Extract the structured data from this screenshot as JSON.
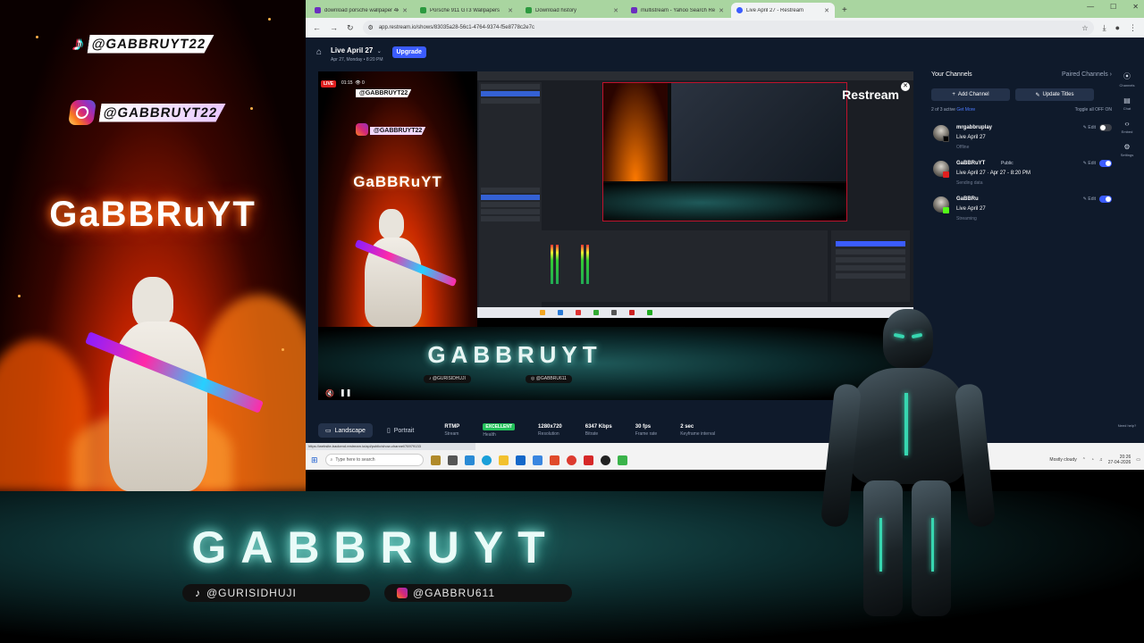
{
  "overlay": {
    "tiktok_handle": "@GABBRUYT22",
    "instagram_handle": "@GABBRUYT22",
    "brand_left": "GaBBRuYT",
    "brand_bottom": "GABBRUYT",
    "bottom_tiktok": "@GURISIDHUJI",
    "bottom_instagram": "@GABBRU611",
    "fire_color": "#ff6a00",
    "teal_glow": "#37d6b0"
  },
  "browser": {
    "tabs": [
      {
        "label": "download porsche wallpaper 4k",
        "favicon_color": "#6b2fbf",
        "active": false
      },
      {
        "label": "Porsche 911 GT3 Wallpapers",
        "favicon_color": "#2c9a3f",
        "active": false
      },
      {
        "label": "Download history",
        "favicon_color": "#2c9a3f",
        "active": false
      },
      {
        "label": "multistream - Yahoo Search Re",
        "favicon_color": "#6b2fbf",
        "active": false
      },
      {
        "label": "Live April 27 - Restream",
        "favicon_color": "#3b5cff",
        "active": true
      }
    ],
    "new_tab": "+",
    "url": "app.restream.io/shows/83035a28-56c1-4764-9374-f5e8778c2e7c",
    "status_url": "https://website-backend.restream.io/api/public/show-channel/76979133"
  },
  "app": {
    "stream_title": "Live April 27",
    "stream_subtitle": "Apr 27, Monday • 8:20 PM",
    "upgrade_label": "Upgrade",
    "preview": {
      "live_badge": "LIVE",
      "live_time": "01:15",
      "viewers": "0",
      "restream_watermark": "Restream",
      "brand_vertical": "GaBBRuYT",
      "brand_banner": "GABBRUYT",
      "banner_tiktok": "@GURISIDHUJI",
      "banner_instagram": "@GABBRU611",
      "mini_tiktok": "@GABBRUYT22",
      "mini_instagram": "@GABBRUYT22"
    },
    "orientation": {
      "landscape": "Landscape",
      "portrait": "Portrait"
    },
    "stats": [
      {
        "value": "RTMP",
        "label": "Stream",
        "badge": false
      },
      {
        "value": "EXCELLENT",
        "label": "Health",
        "badge": true
      },
      {
        "value": "1280x720",
        "label": "Resolution",
        "badge": false
      },
      {
        "value": "6347 Kbps",
        "label": "Bitrate",
        "badge": false
      },
      {
        "value": "30 fps",
        "label": "Frame rate",
        "badge": false
      },
      {
        "value": "2 sec",
        "label": "Keyframe interval",
        "badge": false
      }
    ],
    "channels": {
      "heading": "Your Channels",
      "paired": "Paired Channels",
      "add_label": "Add Channel",
      "update_label": "Update Titles",
      "active_count": "2 of 3 active",
      "get_more": "Get More",
      "toggle_all": "Toggle all",
      "off": "OFF",
      "on": "ON",
      "items": [
        {
          "name": "mrgabbruplay",
          "privacy": "",
          "title": "Live April 27",
          "state": "Offline",
          "edit": "Edit",
          "enabled": false,
          "platform_color": "#000000"
        },
        {
          "name": "GaBBRuYT",
          "privacy": "Public",
          "title": "Live April 27 · Apr 27 - 8:20 PM",
          "state": "Sending data",
          "edit": "Edit",
          "enabled": true,
          "platform_color": "#e01f1f"
        },
        {
          "name": "GaBBRu",
          "privacy": "",
          "title": "Live April 27",
          "state": "Streaming",
          "edit": "Edit",
          "enabled": true,
          "platform_color": "#53fc18"
        }
      ]
    },
    "rail": [
      {
        "icon": "channels-icon",
        "label": "Channels"
      },
      {
        "icon": "chat-icon",
        "label": "Chat"
      },
      {
        "icon": "embed-icon",
        "label": "Embed"
      },
      {
        "icon": "settings-icon",
        "label": "Settings"
      }
    ],
    "need_help": "Need help?"
  },
  "taskbar": {
    "search_placeholder": "Type here to search",
    "weather": "Mostly cloudy",
    "time": "20:26",
    "date": "27-04-2026"
  }
}
